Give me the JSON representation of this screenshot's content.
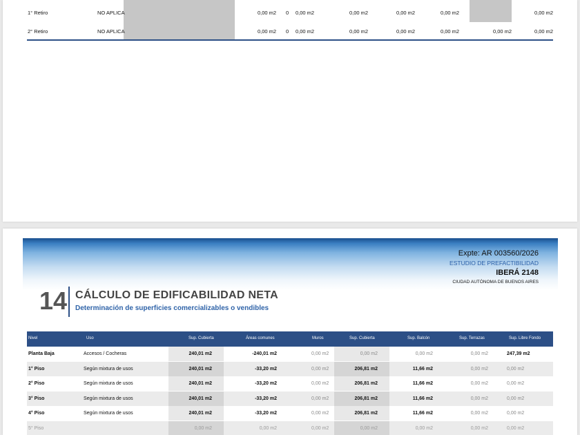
{
  "retiros": [
    {
      "label": "1° Retiro",
      "aplica": "NO APLICA",
      "c1": "0,00 m2",
      "z": "0",
      "c2": "0,00 m2",
      "c3": "0,00 m2",
      "c4": "0,00 m2",
      "c5": "0,00 m2",
      "c6": "",
      "c7": "0,00 m2"
    },
    {
      "label": "2° Retiro",
      "aplica": "NO APLICA",
      "c1": "0,00 m2",
      "z": "0",
      "c2": "0,00 m2",
      "c3": "0,00 m2",
      "c4": "0,00 m2",
      "c5": "0,00 m2",
      "c6": "0,00 m2",
      "c7": "0,00 m2"
    }
  ],
  "header": {
    "expte": "Expte: AR 003560/2026",
    "estudio": "ESTUDIO DE PREFACTIBILIDAD",
    "address": "IBERÁ 2148",
    "city": "CIUDAD AUTÓNOMA DE BUENOS AIRES"
  },
  "section": {
    "number": "14",
    "title": "CÁLCULO DE EDIFICABILIDAD NETA",
    "subtitle": "Determinación de superficies comercializables o vendibles"
  },
  "table": {
    "columns": [
      "Nivel",
      "Uso",
      "Sup. Cubierta",
      "Áreas comunes",
      "Muros",
      "Sup. Cubierta",
      "Sup. Balcón",
      "Sup. Terrazas",
      "Sup. Libre Fondo"
    ],
    "rows": [
      {
        "nivel": "Planta Baja",
        "uso": "Accesos / Cocheras",
        "sup": "240,01 m2",
        "areas": "-240,01 m2",
        "muros": "0,00 m2",
        "sup2": "0,00 m2",
        "balcon": "0,00 m2",
        "terrazas": "0,00 m2",
        "libre": "247,39 m2"
      },
      {
        "nivel": "1° Piso",
        "uso": "Según mixtura de usos",
        "sup": "240,01 m2",
        "areas": "-33,20 m2",
        "muros": "0,00 m2",
        "sup2": "206,81 m2",
        "balcon": "11,66 m2",
        "terrazas": "0,00 m2",
        "libre": "0,00 m2"
      },
      {
        "nivel": "2° Piso",
        "uso": "Según mixtura de usos",
        "sup": "240,01 m2",
        "areas": "-33,20 m2",
        "muros": "0,00 m2",
        "sup2": "206,81 m2",
        "balcon": "11,66 m2",
        "terrazas": "0,00 m2",
        "libre": "0,00 m2"
      },
      {
        "nivel": "3° Piso",
        "uso": "Según mixtura de usos",
        "sup": "240,01 m2",
        "areas": "-33,20 m2",
        "muros": "0,00 m2",
        "sup2": "206,81 m2",
        "balcon": "11,66 m2",
        "terrazas": "0,00 m2",
        "libre": "0,00 m2"
      },
      {
        "nivel": "4° Piso",
        "uso": "Según mixtura de usos",
        "sup": "240,01 m2",
        "areas": "-33,20 m2",
        "muros": "0,00 m2",
        "sup2": "206,81 m2",
        "balcon": "11,66 m2",
        "terrazas": "0,00 m2",
        "libre": "0,00 m2"
      },
      {
        "nivel": "5° Piso",
        "uso": "",
        "sup": "0,00 m2",
        "areas": "0,00 m2",
        "muros": "0,00 m2",
        "sup2": "0,00 m2",
        "balcon": "0,00 m2",
        "terrazas": "0,00 m2",
        "libre": "0,00 m2"
      }
    ]
  },
  "colors": {
    "accent": "#2c4f86",
    "link": "#2f63a8",
    "gray_cell": "#c6c6c6"
  }
}
